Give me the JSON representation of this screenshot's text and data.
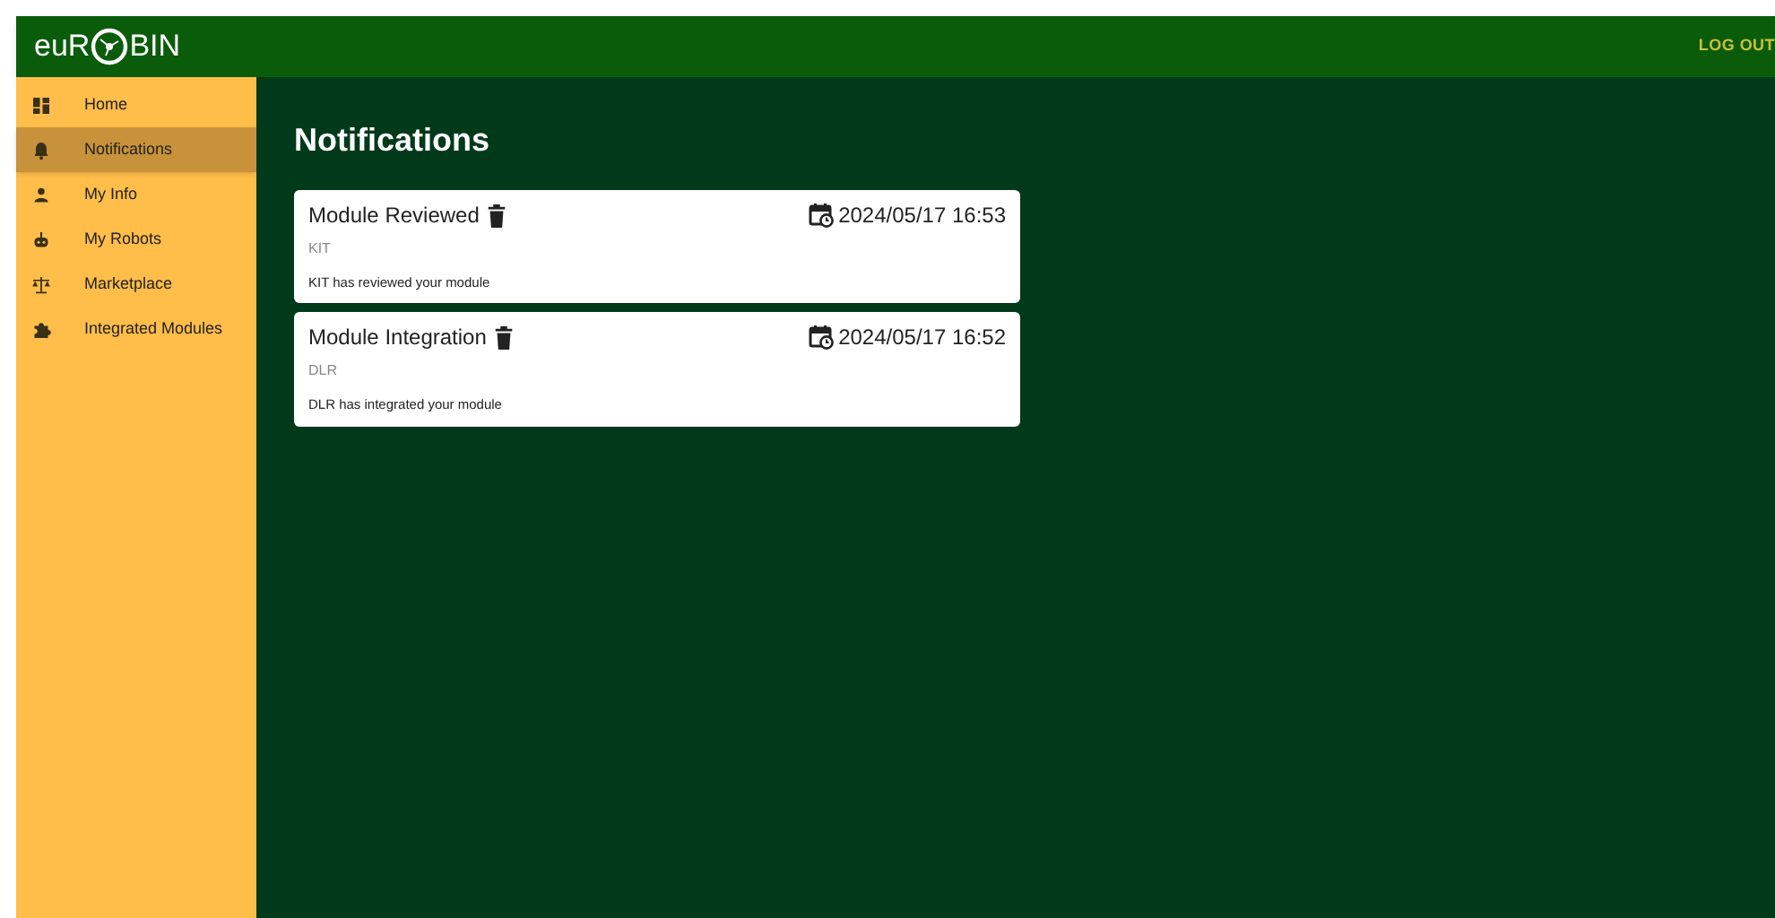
{
  "header": {
    "logo_left": "euR",
    "logo_right": "BIN",
    "logout": "LOG OUT"
  },
  "sidebar": {
    "items": [
      {
        "label": "Home",
        "kind": "dashboard",
        "selected": false
      },
      {
        "label": "Notifications",
        "kind": "bell",
        "selected": true
      },
      {
        "label": "My Info",
        "kind": "person",
        "selected": false
      },
      {
        "label": "My Robots",
        "kind": "robot",
        "selected": false
      },
      {
        "label": "Marketplace",
        "kind": "scale",
        "selected": false
      },
      {
        "label": "Integrated Modules",
        "kind": "puzzle",
        "selected": false
      }
    ]
  },
  "page_title": "Notifications",
  "notifications": [
    {
      "title": "Module Reviewed",
      "date": "2024/05/17 16:53",
      "sender": "KIT",
      "message": "KIT has reviewed your module"
    },
    {
      "title": "Module Integration",
      "date": "2024/05/17 16:52",
      "sender": "DLR",
      "message": "DLR has integrated your module"
    }
  ]
}
